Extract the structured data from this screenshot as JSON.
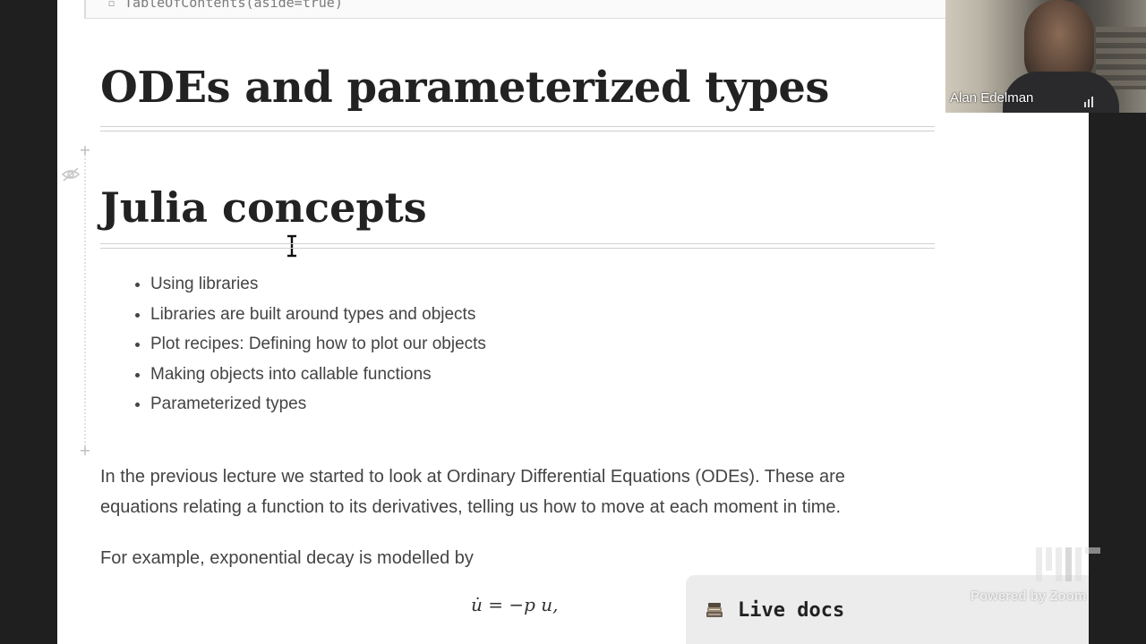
{
  "notebook": {
    "toc_code": "TableOfContents(aside=true)",
    "heading_main": "ODEs and parameterized types",
    "heading_section": "Julia concepts",
    "concepts": [
      "Using libraries",
      "Libraries are built around types and objects",
      "Plot recipes: Defining how to plot our objects",
      "Making objects into callable functions",
      "Parameterized types"
    ],
    "paragraph_1": "In the previous lecture we started to look at Ordinary Differential Equations (ODEs). These are equations relating a function to its derivatives, telling us how to move at each moment in time.",
    "paragraph_2": "For example, exponential decay is modelled by",
    "equation": "u̇ = −p u,",
    "add_cell_symbol": "+"
  },
  "live_docs": {
    "label": "Live docs",
    "icon": "books-icon"
  },
  "video": {
    "participant_name": "Alan Edelman",
    "icon": "audio-level-icon"
  },
  "watermark": {
    "text": "Powered by Zoom",
    "logo": "mit-logo"
  },
  "colors": {
    "page_bg": "#ffffff",
    "heading": "#222222",
    "body_text": "#444444",
    "live_docs_bg": "#ececec"
  }
}
